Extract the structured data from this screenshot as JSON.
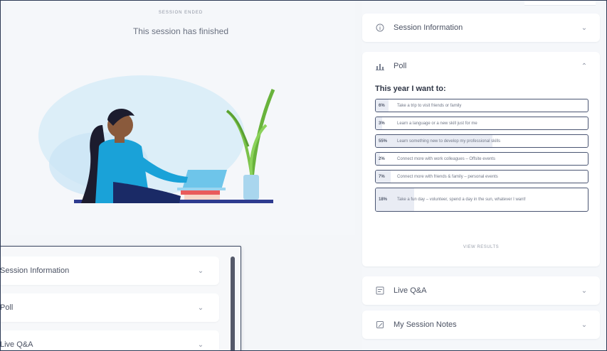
{
  "stage": {
    "status": "SESSION ENDED",
    "headline": "This session has finished"
  },
  "sidebar": {
    "session_info": {
      "label": "Session Information",
      "icon": "info-icon"
    },
    "poll": {
      "label": "Poll",
      "icon": "bar-chart-icon",
      "question": "This year I want to:",
      "options": [
        {
          "percent": "6%",
          "value": 0.06,
          "text": "Take a trip to visit friends or family"
        },
        {
          "percent": "3%",
          "value": 0.03,
          "text": "Learn a language or a new skill just for me"
        },
        {
          "percent": "55%",
          "value": 0.55,
          "text": "Learn something new to develop my professional skills"
        },
        {
          "percent": "2%",
          "value": 0.02,
          "text": "Connect more with work colleagues – Offsite events"
        },
        {
          "percent": "7%",
          "value": 0.07,
          "text": "Connect more with friends & family – personal events"
        },
        {
          "percent": "18%",
          "value": 0.18,
          "text": "Take a fun day – volunteer, spend a day in the sun, whatever I want!"
        }
      ],
      "results_note": "VIEW RESULTS"
    },
    "live_qa": {
      "label": "Live Q&A",
      "icon": "chat-icon"
    },
    "notes": {
      "label": "My Session Notes",
      "icon": "notes-icon"
    }
  },
  "overlay": {
    "items": [
      {
        "label": "Session Information"
      },
      {
        "label": "Poll"
      },
      {
        "label": "Live Q&A"
      }
    ]
  },
  "colors": {
    "accent_border": "#4a5572",
    "shirt": "#1aa2d8",
    "laptop": "#6ec5ea",
    "plant": "#7cc24a",
    "blob": "#d6ebf7"
  }
}
